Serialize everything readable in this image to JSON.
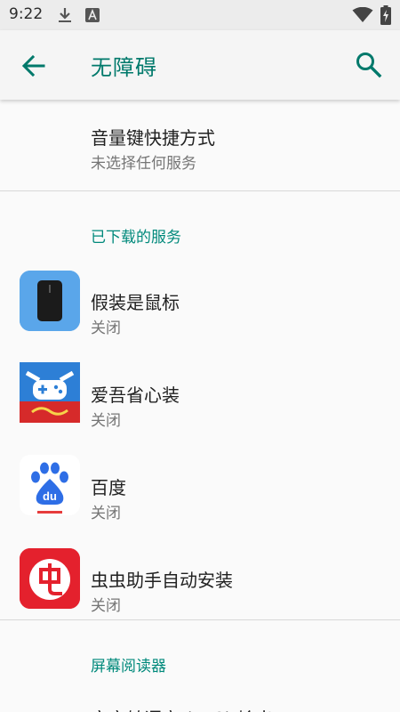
{
  "status_bar": {
    "time": "9:22",
    "icons": [
      "download-icon",
      "font-a-icon",
      "wifi-icon",
      "battery-charging-icon"
    ]
  },
  "app_bar": {
    "title": "无障碍",
    "back_icon": "arrow-back-icon",
    "search_icon": "search-icon",
    "accent": "#00796b"
  },
  "volume_shortcut": {
    "title": "音量键快捷方式",
    "summary": "未选择任何服务"
  },
  "downloaded_services": {
    "header": "已下载的服务",
    "items": [
      {
        "title": "假装是鼠标",
        "summary": "关闭",
        "icon": "mouse-app-icon"
      },
      {
        "title": "爱吾省心装",
        "summary": "关闭",
        "icon": "aiwu-app-icon"
      },
      {
        "title": "百度",
        "summary": "关闭",
        "icon": "baidu-app-icon"
      },
      {
        "title": "虫虫助手自动安装",
        "summary": "关闭",
        "icon": "chongchong-app-icon"
      }
    ]
  },
  "screen_readers": {
    "header": "屏幕阅读器",
    "partial_item": "文字转语音 (TTS) 输出"
  }
}
